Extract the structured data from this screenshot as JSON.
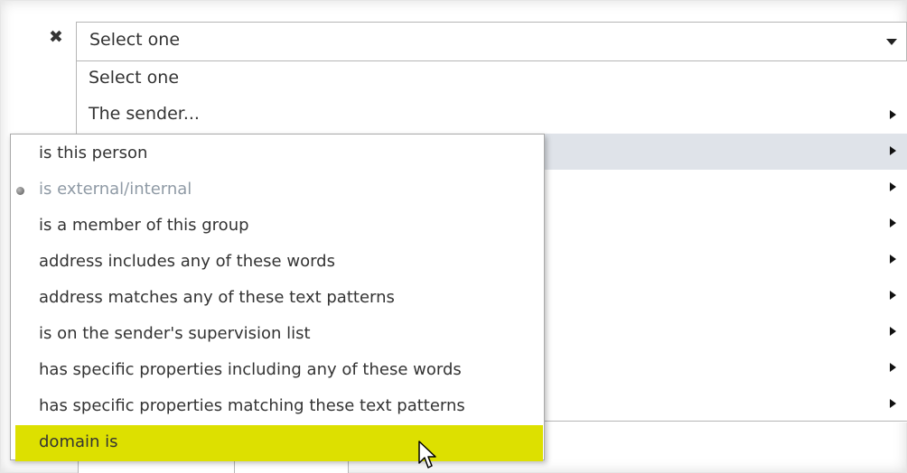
{
  "condition_row": {
    "remove_glyph": "✖",
    "selected_value": "Select one"
  },
  "dropdown": {
    "options": [
      {
        "label": "Select one",
        "has_submenu": false
      },
      {
        "label": "The sender...",
        "has_submenu": true
      },
      {
        "label": "",
        "has_submenu": true,
        "highlighted": true
      },
      {
        "label": "",
        "has_submenu": true
      },
      {
        "label": "",
        "has_submenu": true
      },
      {
        "label": "",
        "has_submenu": true
      },
      {
        "label": "",
        "has_submenu": true
      },
      {
        "label": "",
        "has_submenu": true
      },
      {
        "label": "",
        "has_submenu": true
      },
      {
        "label": "",
        "has_submenu": true
      }
    ]
  },
  "submenu": {
    "items": [
      {
        "label": "is this person"
      },
      {
        "label": "is external/internal",
        "selected": true,
        "disabled": true
      },
      {
        "label": "is a member of this group"
      },
      {
        "label": "address includes any of these words"
      },
      {
        "label": "address matches any of these text patterns"
      },
      {
        "label": "is on the sender's supervision list"
      },
      {
        "label": "has specific properties including any of these words"
      },
      {
        "label": "has specific properties matching these text patterns"
      },
      {
        "label": "domain is",
        "hovered": true
      }
    ]
  },
  "colors": {
    "hover_highlight": "#dde000",
    "row_highlight": "#dfe3e9",
    "disabled_text": "#8f9aa5"
  }
}
